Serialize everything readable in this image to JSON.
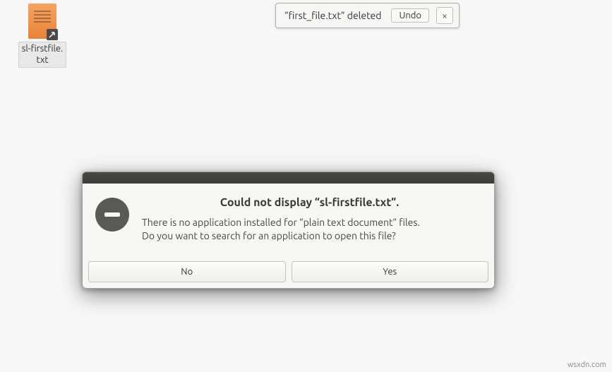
{
  "desktop": {
    "file": {
      "label": "sl-firstfile.\ntxt",
      "icon_name": "text-file-icon"
    }
  },
  "toast": {
    "message": "“first_file.txt” deleted",
    "undo_label": "Undo",
    "close_label": "×"
  },
  "dialog": {
    "icon_name": "no-entry-icon",
    "title": "Could not display “sl-firstfile.txt”.",
    "body_line1": "There is no application installed for “plain text document” files.",
    "body_line2": "Do you want to search for an application to open this file?",
    "no_label": "No",
    "yes_label": "Yes"
  },
  "watermark": "wsxdn.com"
}
